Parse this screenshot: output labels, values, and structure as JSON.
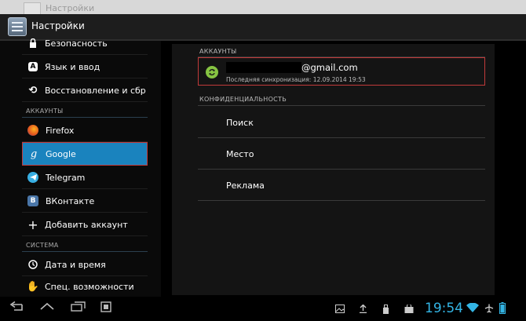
{
  "background": {
    "ghost_title": "Настройки"
  },
  "action_bar": {
    "title": "Настройки",
    "icon": "settings-sliders-icon"
  },
  "sidebar": {
    "items_top": [
      {
        "label": "Безопасность",
        "icon": "lock-icon"
      },
      {
        "label": "Язык и ввод",
        "icon": "keyboard-a-icon"
      },
      {
        "label": "Восстановление и сбр",
        "icon": "restore-icon"
      }
    ],
    "section_accounts": "АККАУНТЫ",
    "accounts": [
      {
        "label": "Firefox",
        "icon": "firefox-icon"
      },
      {
        "label": "Google",
        "icon": "google-icon",
        "selected": true
      },
      {
        "label": "Telegram",
        "icon": "telegram-icon"
      },
      {
        "label": "ВКонтакте",
        "icon": "vk-icon"
      },
      {
        "label": "Добавить аккаунт",
        "icon": "plus-icon"
      }
    ],
    "section_system": "СИСТЕМА",
    "items_system": [
      {
        "label": "Дата и время",
        "icon": "clock-icon"
      },
      {
        "label": "Спец. возможности",
        "icon": "hand-icon"
      }
    ]
  },
  "detail": {
    "section_accounts": "АККАУНТЫ",
    "account": {
      "email": "@gmail.com",
      "sync_status": "Последняя синхронизация: 12.09.2014 19:53",
      "icon": "sync-icon"
    },
    "section_privacy": "КОНФИДЕНЦИАЛЬНОСТЬ",
    "privacy_items": [
      "Поиск",
      "Место",
      "Реклама"
    ]
  },
  "system_bar": {
    "time": "19:54",
    "icons": [
      "back-icon",
      "home-icon",
      "recent-apps-icon",
      "screenshot-icon",
      "gallery-icon",
      "upload-icon",
      "usb-icon",
      "shop-icon",
      "wifi-icon",
      "airplane-icon",
      "battery-icon"
    ]
  },
  "colors": {
    "accent": "#33b5e5",
    "selection": "#1a83be",
    "highlight_border": "#c23a3a",
    "sync_green": "#86c442"
  }
}
